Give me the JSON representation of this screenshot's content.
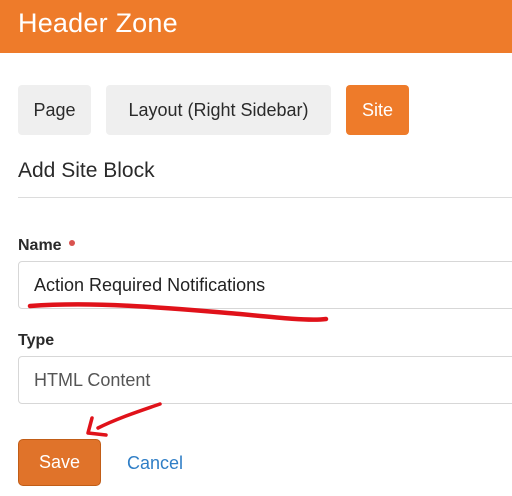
{
  "header": {
    "title": "Header Zone"
  },
  "tabs": [
    {
      "label": "Page",
      "active": false
    },
    {
      "label": "Layout (Right Sidebar)",
      "active": false
    },
    {
      "label": "Site",
      "active": true
    }
  ],
  "section": {
    "title": "Add Site Block"
  },
  "form": {
    "name": {
      "label": "Name",
      "required": true,
      "value": "Action Required Notifications"
    },
    "type": {
      "label": "Type",
      "value": "HTML Content"
    }
  },
  "actions": {
    "save_label": "Save",
    "cancel_label": "Cancel"
  },
  "colors": {
    "accent": "#ee7b2a",
    "link": "#2f7ec6",
    "required": "#d9534f",
    "annotation": "#e0121a"
  }
}
